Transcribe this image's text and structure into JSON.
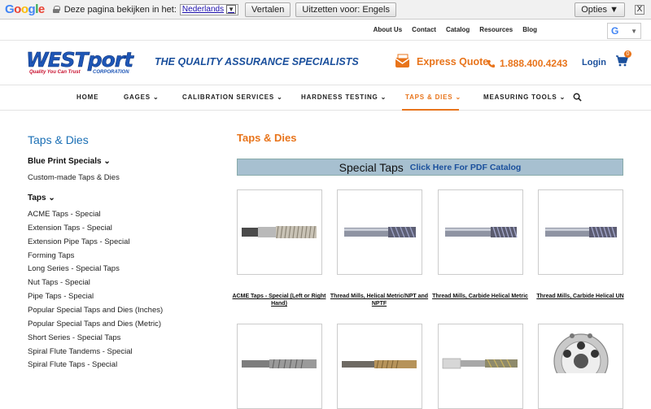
{
  "translate_bar": {
    "brand": [
      "G",
      "o",
      "o",
      "g",
      "l",
      "e"
    ],
    "message": "Deze pagina bekijken in het:",
    "language": "Nederlands",
    "translate_button": "Vertalen",
    "turn_off_button": "Uitzetten voor: Engels",
    "options_button": "Opties ▼",
    "close": "X"
  },
  "utility_nav": [
    "About Us",
    "Contact",
    "Catalog",
    "Resources",
    "Blog"
  ],
  "google_translate_widget": {
    "glyph": "G",
    "arrow": "▼"
  },
  "header": {
    "logo_text": "WESTport",
    "logo_tagline": "Quality You Can Trust",
    "logo_corp": "CORPORATION",
    "slogan": "THE QUALITY ASSURANCE SPECIALISTS",
    "express_quote": "Express Quote",
    "phone": "1.888.400.4243",
    "login": "Login",
    "cart_count": "0"
  },
  "main_nav": [
    {
      "label": "HOME",
      "chevron": ""
    },
    {
      "label": "GAGES",
      "chevron": "⌄"
    },
    {
      "label": "CALIBRATION SERVICES",
      "chevron": "⌄"
    },
    {
      "label": "HARDNESS TESTING",
      "chevron": "⌄"
    },
    {
      "label": "TAPS & DIES",
      "chevron": "⌄"
    },
    {
      "label": "MEASURING TOOLS",
      "chevron": "⌄"
    }
  ],
  "colors": {
    "accent": "#e8741b",
    "brand_blue": "#1a4f9c",
    "banner": "#a7c0d0"
  },
  "sidebar": {
    "title": "Taps & Dies",
    "sections": [
      {
        "label": "Blue Print Specials",
        "chevron": "⌄",
        "items": [
          "Custom-made Taps & Dies"
        ]
      },
      {
        "label": "Taps",
        "chevron": "⌄",
        "items": [
          "ACME Taps - Special",
          "Extension Taps - Special",
          "Extension Pipe Taps - Special",
          "Forming Taps",
          "Long Series - Special Taps",
          "Nut Taps - Special",
          "Pipe Taps - Special",
          "Popular Special Taps and Dies (Inches)",
          "Popular Special Taps and Dies (Metric)",
          "Short Series - Special Taps",
          "Spiral Flute Tandems - Special",
          "Spiral Flute Taps - Special"
        ]
      }
    ]
  },
  "main": {
    "title": "Taps & Dies",
    "banner_title": "Special Taps",
    "banner_link": "Click Here For PDF Catalog",
    "products": [
      {
        "caption": "ACME Taps - Special (Left or Right Hand)",
        "icon": "tap-image"
      },
      {
        "caption": "Thread Mills, Helical Metric/NPT and NPTF",
        "icon": "thread-mill-image"
      },
      {
        "caption": "Thread Mills, Carbide Helical Metric",
        "icon": "thread-mill-image"
      },
      {
        "caption": "Thread Mills, Carbide Helical UN",
        "icon": "thread-mill-image"
      },
      {
        "caption": "",
        "icon": "tap-image"
      },
      {
        "caption": "",
        "icon": "tap-image"
      },
      {
        "caption": "",
        "icon": "drill-image"
      },
      {
        "caption": "",
        "icon": "die-image"
      }
    ]
  }
}
